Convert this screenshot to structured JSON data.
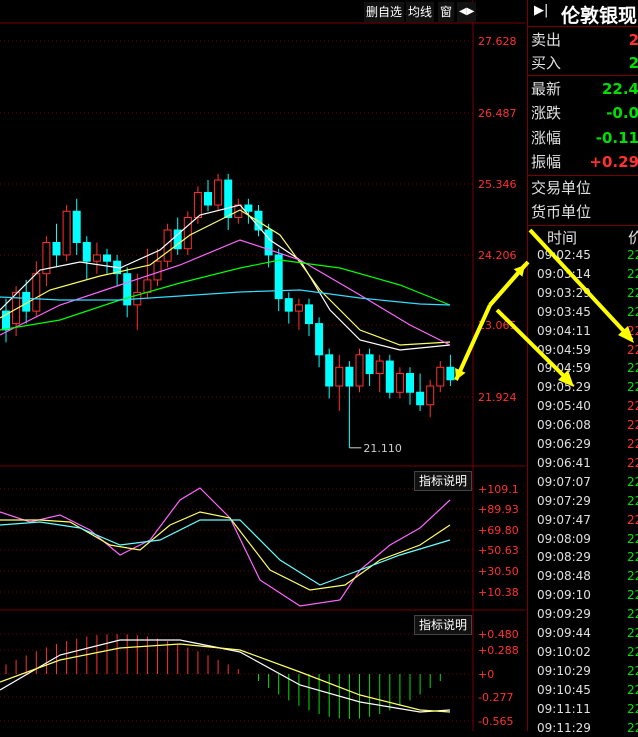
{
  "toolbar": {
    "delete_fav": "删自选",
    "avg_line": "均线",
    "window": "窗",
    "arrow": "◀▶"
  },
  "price_axis": [
    "27.628",
    "26.487",
    "25.346",
    "24.206",
    "23.065",
    "21.924"
  ],
  "low_label": "21.110",
  "indicator_button": "指标说明",
  "kdj_axis": [
    "+109.1",
    "+89.93",
    "+69.80",
    "+50.63",
    "+30.50",
    "+10.38"
  ],
  "macd_axis": [
    "+0.480",
    "+0.288",
    "+0",
    "-0.277",
    "-0.565"
  ],
  "side": {
    "title": "伦敦银现",
    "sell_label": "卖出",
    "sell_val": "2",
    "buy_label": "买入",
    "buy_val": "2",
    "latest_label": "最新",
    "latest_val": "22.4",
    "change_label": "涨跌",
    "change_val": "-0.0",
    "pct_label": "涨幅",
    "pct_val": "-0.11",
    "amp_label": "振幅",
    "amp_val": "+0.29",
    "unit_label": "交易单位",
    "currency_label": "货币单位",
    "time_header": "时间",
    "price_header": "价"
  },
  "ticks": [
    {
      "time": "09:02:45",
      "price": "22",
      "color": "#00e000"
    },
    {
      "time": "09:03:14",
      "price": "22",
      "color": "#00e000"
    },
    {
      "time": "09:03:29",
      "price": "22",
      "color": "#00e000"
    },
    {
      "time": "09:03:45",
      "price": "22",
      "color": "#00e000"
    },
    {
      "time": "09:04:11",
      "price": "22",
      "color": "#ff3030"
    },
    {
      "time": "09:04:59",
      "price": "22",
      "color": "#ff3030"
    },
    {
      "time": "09:04:59",
      "price": "22",
      "color": "#00e000"
    },
    {
      "time": "09:05:29",
      "price": "22",
      "color": "#00e000"
    },
    {
      "time": "09:05:40",
      "price": "22",
      "color": "#ff3030"
    },
    {
      "time": "09:06:08",
      "price": "22",
      "color": "#ff3030"
    },
    {
      "time": "09:06:29",
      "price": "22",
      "color": "#ff3030"
    },
    {
      "time": "09:06:41",
      "price": "22",
      "color": "#ff3030"
    },
    {
      "time": "09:07:07",
      "price": "22",
      "color": "#00e000"
    },
    {
      "time": "09:07:29",
      "price": "22",
      "color": "#00e000"
    },
    {
      "time": "09:07:47",
      "price": "22",
      "color": "#ff3030"
    },
    {
      "time": "09:08:09",
      "price": "22",
      "color": "#00e000"
    },
    {
      "time": "09:08:29",
      "price": "22",
      "color": "#00e000"
    },
    {
      "time": "09:08:48",
      "price": "22",
      "color": "#00e000"
    },
    {
      "time": "09:09:10",
      "price": "22",
      "color": "#00e000"
    },
    {
      "time": "09:09:29",
      "price": "22",
      "color": "#00e000"
    },
    {
      "time": "09:09:44",
      "price": "22",
      "color": "#00e000"
    },
    {
      "time": "09:10:02",
      "price": "22",
      "color": "#00e000"
    },
    {
      "time": "09:10:29",
      "price": "22",
      "color": "#00e000"
    },
    {
      "time": "09:10:45",
      "price": "22",
      "color": "#00e000"
    },
    {
      "time": "09:11:11",
      "price": "22",
      "color": "#00e000"
    },
    {
      "time": "09:11:29",
      "price": "22",
      "color": "#00e000"
    }
  ],
  "colors": {
    "up": "#ff3030",
    "down": "#00ffff",
    "grid": "#7a0000",
    "axis_text": "#ff3030",
    "arrow": "#ffff00"
  }
}
